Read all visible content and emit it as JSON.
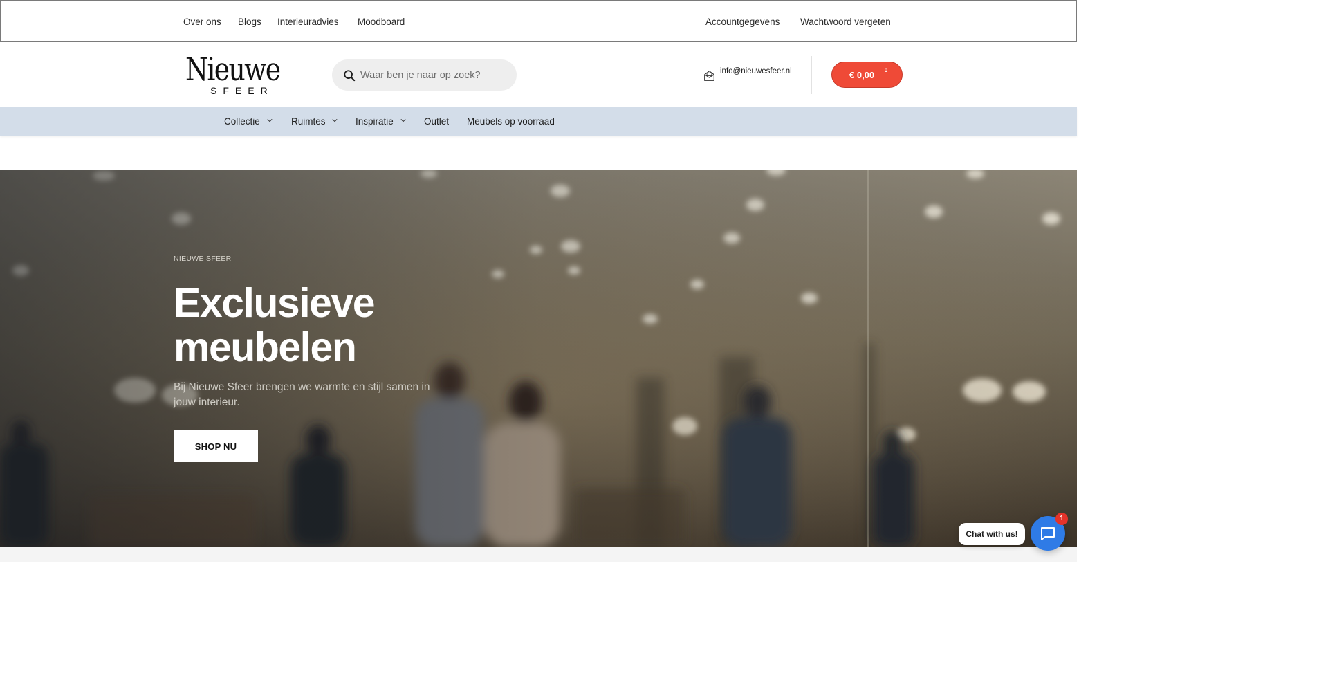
{
  "topbar": {
    "left_links": [
      "Over ons",
      "Blogs",
      "Interieuradvies",
      "Moodboard"
    ],
    "right_links": [
      "Accountgegevens",
      "Wachtwoord vergeten"
    ]
  },
  "header": {
    "logo_line1": "Nieuwe",
    "logo_line2": "SFEER",
    "search_placeholder": "Waar ben je naar op zoek?",
    "email": "info@nieuwesfeer.nl",
    "cart_total": "€ 0,00",
    "cart_count": "0"
  },
  "mainnav": {
    "items": [
      {
        "label": "Collectie",
        "dropdown": true
      },
      {
        "label": "Ruimtes",
        "dropdown": true
      },
      {
        "label": "Inspiratie",
        "dropdown": true
      },
      {
        "label": "Outlet",
        "dropdown": false
      },
      {
        "label": "Meubels op voorraad",
        "dropdown": false
      }
    ]
  },
  "hero": {
    "eyebrow": "NIEUWE SFEER",
    "title": "Exclusieve meubelen",
    "subtitle": "Bij Nieuwe Sfeer brengen we warmte en stijl samen in jouw interieur.",
    "cta": "SHOP NU"
  },
  "chat": {
    "label": "Chat with us!",
    "badge": "1"
  },
  "colors": {
    "accent": "#ef4a37",
    "nav_bg": "#d3dde9",
    "chat_blue": "#2f7be6"
  }
}
